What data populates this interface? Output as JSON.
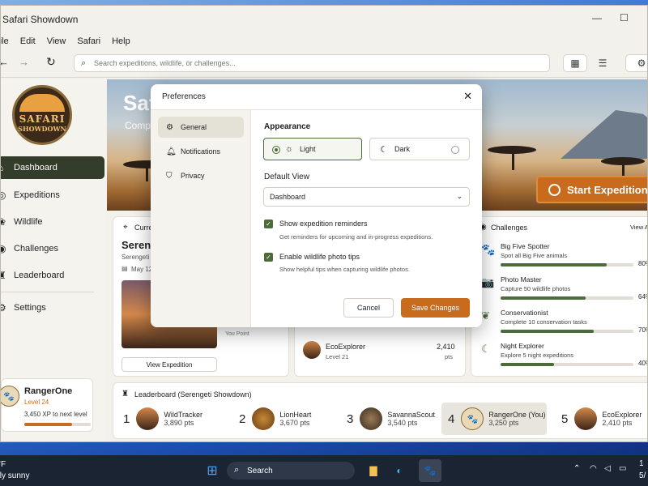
{
  "window": {
    "title": "Safari Showdown",
    "minimize": "—",
    "maximize": "☐"
  },
  "menu": [
    "File",
    "Edit",
    "View",
    "Safari",
    "Help"
  ],
  "toolbar": {
    "search_placeholder": "Search expeditions, wildlife, or challenges..."
  },
  "logo": {
    "line1": "SAFARI",
    "line2": "SHOWDOWN"
  },
  "sidebar": {
    "items": [
      {
        "label": "Dashboard",
        "icon": "home-icon",
        "active": true
      },
      {
        "label": "Expeditions",
        "icon": "compass-icon"
      },
      {
        "label": "Wildlife",
        "icon": "paw-icon"
      },
      {
        "label": "Challenges",
        "icon": "target-icon"
      },
      {
        "label": "Leaderboard",
        "icon": "trophy-icon"
      },
      {
        "label": "Settings",
        "icon": "gear-icon"
      }
    ],
    "user": {
      "name": "RangerOne",
      "level": "Level 24",
      "xp": "3,450 XP to next level",
      "progress_pct": 72
    }
  },
  "hero": {
    "title": "Safari",
    "subtitle": "Comp",
    "cta": "Start Expedition"
  },
  "current": {
    "header": "Curre",
    "title": "Sereng",
    "place": "Serengeti N",
    "date": "May 12",
    "view_button": "View Expedition",
    "cut_text": "You Point"
  },
  "leaders_mini": [
    {
      "name": "EcoExplorer",
      "level": "Level 21",
      "pts": "2,410",
      "unit": "pts"
    }
  ],
  "challenges": {
    "title": "Challenges",
    "view_all": "View A",
    "items": [
      {
        "name": "Big Five Spotter",
        "desc": "Spot all Big Five animals",
        "pct": 80,
        "pct_label": "80%"
      },
      {
        "name": "Photo Master",
        "desc": "Capture 50 wildlife photos",
        "pct": 64,
        "pct_label": "64%"
      },
      {
        "name": "Conservationist",
        "desc": "Complete 10 conservation tasks",
        "pct": 70,
        "pct_label": "70%"
      },
      {
        "name": "Night Explorer",
        "desc": "Explore 5 night expeditions",
        "pct": 40,
        "pct_label": "40%"
      }
    ]
  },
  "leaderboard": {
    "title": "Leaderboard (Serengeti Showdown)",
    "entries": [
      {
        "rank": "1",
        "name": "WildTracker",
        "pts": "3,890 pts"
      },
      {
        "rank": "2",
        "name": "LionHeart",
        "pts": "3,670 pts"
      },
      {
        "rank": "3",
        "name": "SavannaScout",
        "pts": "3,540 pts"
      },
      {
        "rank": "4",
        "name": "RangerOne (You)",
        "pts": "3,250 pts",
        "highlight": true
      },
      {
        "rank": "5",
        "name": "EcoExplorer",
        "pts": "2,410 pts"
      }
    ]
  },
  "dialog": {
    "title": "Preferences",
    "nav": [
      {
        "label": "General",
        "icon": "gear-icon",
        "active": true
      },
      {
        "label": "Notifications",
        "icon": "bell-icon"
      },
      {
        "label": "Privacy",
        "icon": "shield-icon"
      }
    ],
    "appearance_label": "Appearance",
    "theme_light": "Light",
    "theme_dark": "Dark",
    "default_view_label": "Default View",
    "default_view_value": "Dashboard",
    "check1_title": "Show expedition reminders",
    "check1_desc": "Get reminders for upcoming and in-progress expeditions.",
    "check2_title": "Enable wildlife photo tips",
    "check2_desc": "Show helpful tips when capturing wildlife photos.",
    "cancel": "Cancel",
    "save": "Save Changes"
  },
  "taskbar": {
    "weather_temp": "°F",
    "weather_text": "tly sunny",
    "search": "Search",
    "time": "1",
    "date": "5/"
  },
  "colors": {
    "accent": "#4d6a3a",
    "brand_orange": "#c96b1c",
    "nav_active": "#343d2c"
  }
}
